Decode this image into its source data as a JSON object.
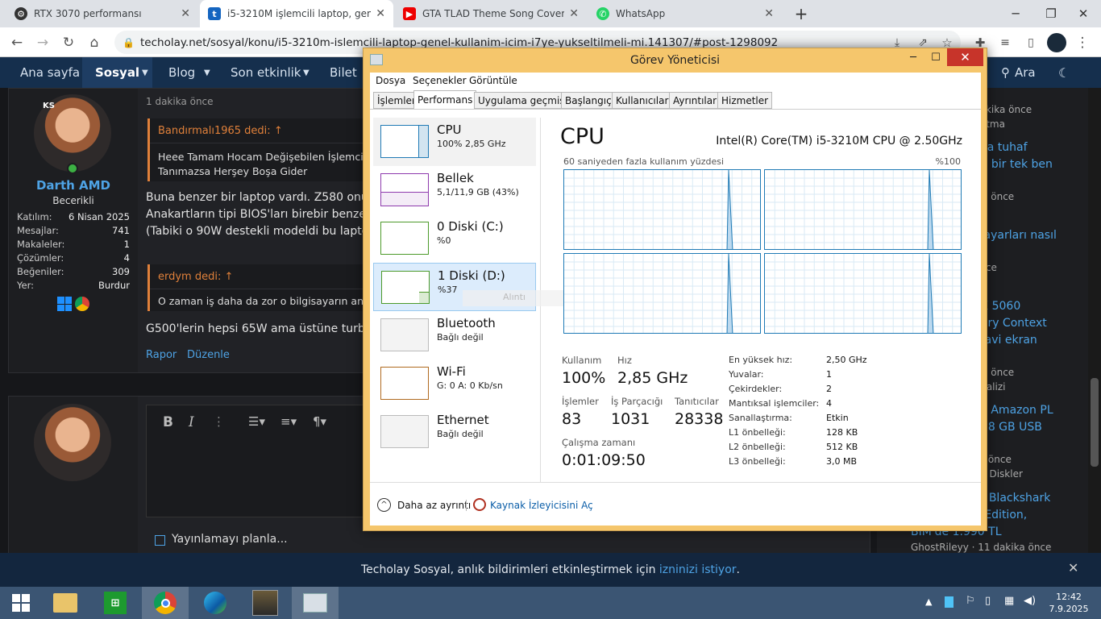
{
  "browser": {
    "tabs": [
      {
        "title": "RTX 3070 performansı",
        "active": false
      },
      {
        "title": "i5-3210M işlemcili laptop, genel k",
        "active": true
      },
      {
        "title": "GTA TLAD Theme Song Cover - Y",
        "active": false
      },
      {
        "title": "WhatsApp",
        "active": false
      }
    ],
    "url": "techolay.net/sosyal/konu/i5-3210m-islemcili-laptop-genel-kullanim-icim-i7ye-yukseltilmeli-mi.141307/#post-1298092"
  },
  "site": {
    "nav": [
      "Ana sayfa",
      "Sosyal",
      "Blog",
      "Son etkinlik",
      "Bilet"
    ],
    "search": "Ara",
    "post_time": "1 dakika önce",
    "user": {
      "name": "Darth AMD",
      "rank": "Becerikli",
      "badge": "KS",
      "stats": [
        [
          "Katılım:",
          "6 Nisan 2025"
        ],
        [
          "Mesajlar:",
          "741"
        ],
        [
          "Makaleler:",
          "1"
        ],
        [
          "Çözümler:",
          "4"
        ],
        [
          "Beğeniler:",
          "309"
        ],
        [
          "Yer:",
          "Burdur"
        ]
      ]
    },
    "quote1": {
      "head": "Bandırmalı1965 dedi:",
      "text": "Heee Tamam Hocam Değişebilen İşlemciliym",
      "text2": "Tanımazsa Herşey Boşa Gider"
    },
    "para1": [
      "Buna benzer bir laptop vardı. Z580 onu g",
      "Anakartların tipi BIOS'ları birebir benzer. S",
      "(Tabiki o 90W destekli modeldi bu laptop"
    ],
    "quote2": {
      "head": "erdym dedi:",
      "text": "O zaman iş daha da zor o bilgisayarın anakar"
    },
    "para2": "G500'lerin hepsi 65W ama üstüne turbo b",
    "actions": [
      "Rapor",
      "Düzenle"
    ],
    "schedule": "Yayınlamayı planla...",
    "ghost_quote": "Alıntı",
    "sidebar": [
      {
        "t": "dakika önce",
        "c": "rsg"
      },
      {
        "t": "gutma",
        "c": "rsg"
      },
      {
        "t": "rtta tuhaf",
        "c": "rs"
      },
      {
        "t": "an bir tek ben",
        "c": "rs"
      },
      {
        "t": "ika önce",
        "c": "rsg"
      },
      {
        "t": "k ayarları nasıl",
        "c": "rs"
      },
      {
        "t": "önce",
        "c": "rsg"
      },
      {
        "t": "TX 5060",
        "c": "rs"
      },
      {
        "t": "nory Context",
        "c": "rs"
      },
      {
        "t": "mavi ekran",
        "c": "rs"
      },
      {
        "t": "ika önce",
        "c": "rsg"
      },
      {
        "t": "Analizi",
        "c": "rsg"
      },
      {
        "t": "ve Amazon PL",
        "c": "rs"
      },
      {
        "t": "128 GB USB",
        "c": "rs"
      },
      {
        "t": "ka önce",
        "c": "rsg"
      },
      {
        "t": "bit Diskler",
        "c": "rsg"
      },
      {
        "t": "er Blackshark",
        "c": "rs"
      },
      {
        "t": "n Edition,",
        "c": "rs"
      },
      {
        "t": "BIM'de 1.990 TL",
        "c": "rs"
      },
      {
        "t": "GhostRileyy · 11 dakika önce",
        "c": "rsg"
      }
    ],
    "notify": {
      "text": "Techolay Sosyal, anlık bildirimleri etkinleştirmek için ",
      "link": "izninizi istiyor",
      "end": "."
    }
  },
  "taskmanager": {
    "title": "Görev Yöneticisi",
    "menu": [
      "Dosya",
      "Seçenekler",
      "Görüntüle"
    ],
    "tabs": [
      "İşlemler",
      "Performans",
      "Uygulama geçmişi",
      "Başlangıç",
      "Kullanıcılar",
      "Ayrıntılar",
      "Hizmetler"
    ],
    "items": [
      {
        "name": "CPU",
        "sub": "100% 2,85 GHz",
        "color": "#1f7ab5",
        "level": 1.0
      },
      {
        "name": "Bellek",
        "sub": "5,1/11,9 GB (43%)",
        "color": "#8e3aad",
        "level": 0.43
      },
      {
        "name": "0 Diski (C:)",
        "sub": "%0",
        "color": "#4c9a2a",
        "level": 0.0
      },
      {
        "name": "1 Diski (D:)",
        "sub": "%37",
        "color": "#4c9a2a",
        "level": 0.37
      },
      {
        "name": "Bluetooth",
        "sub": "Bağlı değil",
        "color": "#999999",
        "level": 0
      },
      {
        "name": "Wi-Fi",
        "sub": "G: 0 A: 0 Kb/sn",
        "color": "#b06a1f",
        "level": 0
      },
      {
        "name": "Ethernet",
        "sub": "Bağlı değil",
        "color": "#999999",
        "level": 0
      }
    ],
    "cpu": {
      "heading": "CPU",
      "model": "Intel(R) Core(TM) i5-3210M CPU @ 2.50GHz",
      "graph_label": "60 saniyeden fazla kullanım yüzdesi",
      "graph_max": "%100",
      "kullanim_k": "Kullanım",
      "kullanim_v": "100%",
      "hiz_k": "Hız",
      "hiz_v": "2,85 GHz",
      "islemler_k": "İşlemler",
      "islemler_v": "83",
      "is_k": "İş Parçacığı",
      "is_v": "1031",
      "tanit_k": "Tanıtıcılar",
      "tanit_v": "28338",
      "calisma_k": "Çalışma zamanı",
      "calisma_v": "0:01:09:50",
      "specs": [
        [
          "En yüksek hız:",
          "2,50 GHz"
        ],
        [
          "Yuvalar:",
          "1"
        ],
        [
          "Çekirdekler:",
          "2"
        ],
        [
          "Mantıksal işlemciler:",
          "4"
        ],
        [
          "Sanallaştırma:",
          "Etkin"
        ],
        [
          "L1 önbelleği:",
          "128 KB"
        ],
        [
          "L2 önbelleği:",
          "512 KB"
        ],
        [
          "L3 önbelleği:",
          "3,0 MB"
        ]
      ]
    },
    "footer_less": "Daha az ayrıntı",
    "footer_res": "Kaynak İzleyicisini Aç"
  },
  "taskbar": {
    "time": "12:42",
    "date": "7.9.2025"
  }
}
